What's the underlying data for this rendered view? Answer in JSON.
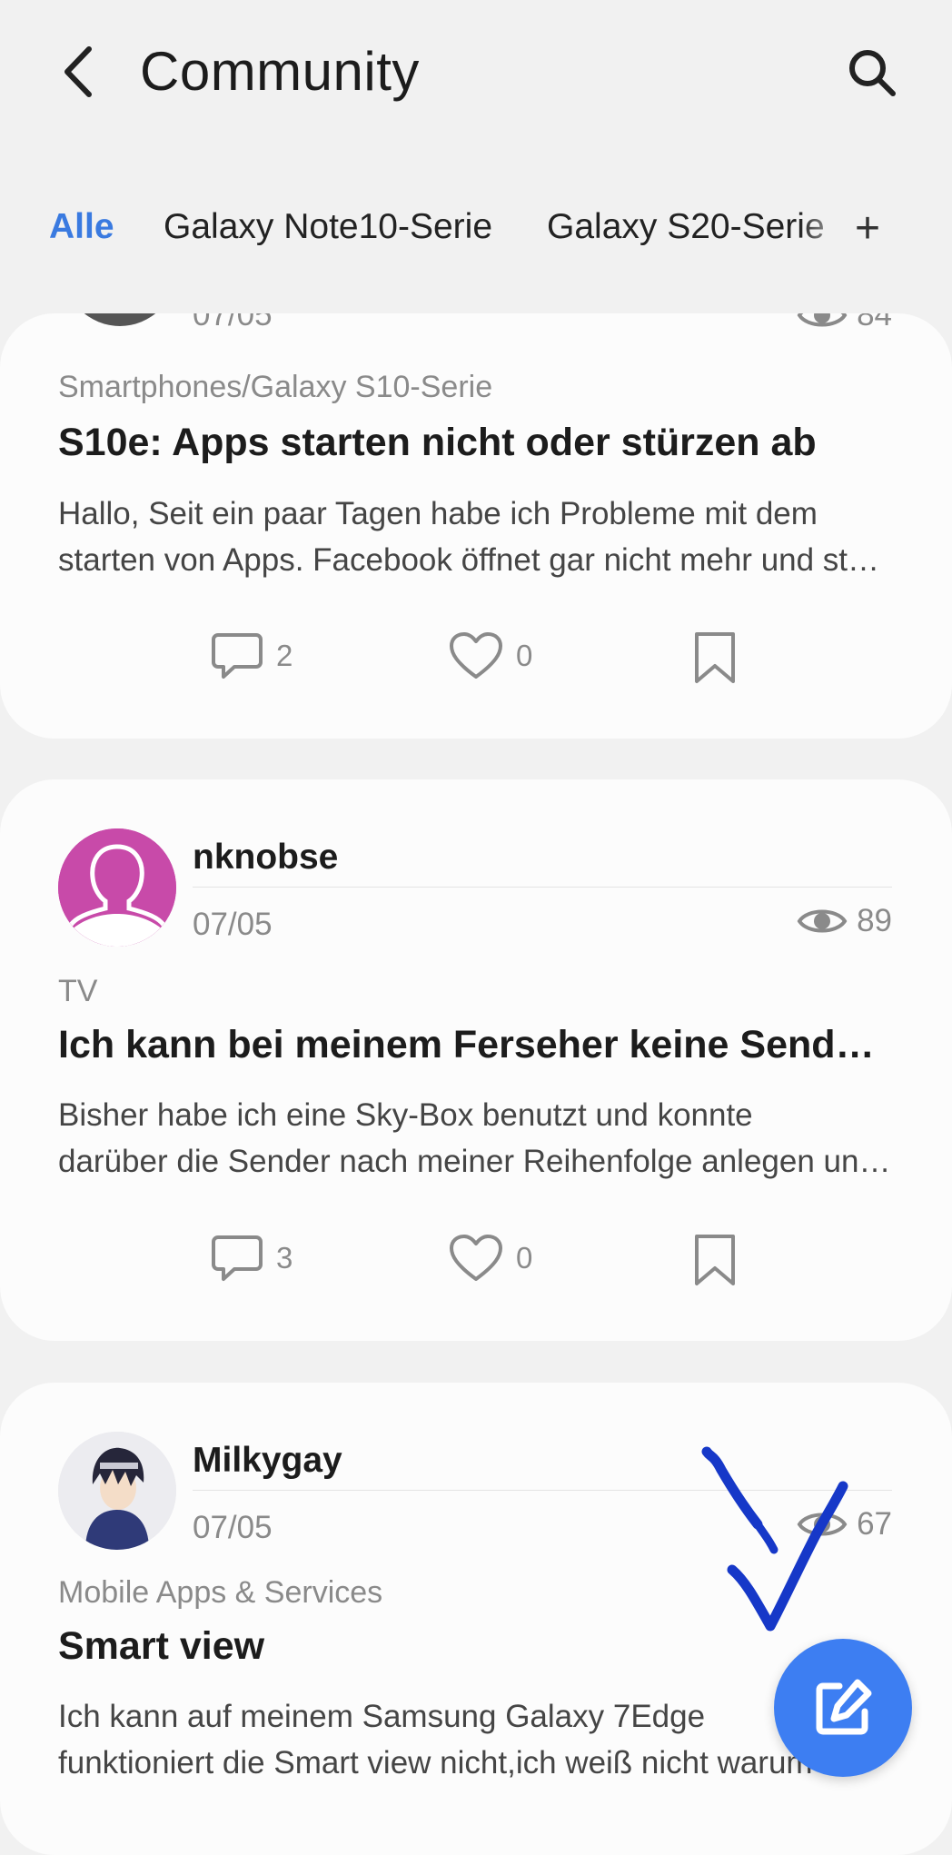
{
  "header": {
    "title": "Community",
    "back_icon": "chevron-left-icon",
    "search_icon": "search-icon"
  },
  "tabs": [
    {
      "label": "Alle",
      "active": true
    },
    {
      "label": "Galaxy Note10-Serie",
      "active": false
    },
    {
      "label": "Galaxy S20-Serie",
      "active": false
    }
  ],
  "tab_add_label": "+",
  "posts": [
    {
      "date": "07/05",
      "views": "84",
      "category": "Smartphones/Galaxy S10-Serie",
      "title": "S10e: Apps starten nicht oder stürzen ab",
      "excerpt_lines": [
        "Hallo, Seit ein paar Tagen habe ich Probleme mit dem",
        "starten von Apps. Facebook öffnet gar nicht mehr und stürzt ab"
      ],
      "comments": "2",
      "likes": "0"
    },
    {
      "author": "nknobse",
      "date": "07/05",
      "views": "89",
      "category": "TV",
      "title": "Ich kann bei meinem Ferseher keine Sender sortieren",
      "excerpt_lines": [
        "Bisher habe ich eine Sky-Box benutzt und konnte",
        "darüber die Sender nach meiner Reihenfolge anlegen und sortieren"
      ],
      "comments": "3",
      "likes": "0"
    },
    {
      "author": "Milkygay",
      "date": "07/05",
      "views": "67",
      "category": "Mobile Apps & Services",
      "title": "Smart view",
      "excerpt_lines": [
        "Ich kann auf meinem Samsung Galaxy 7Edge",
        "funktioniert die Smart view nicht,ich weiß nicht warum"
      ]
    }
  ],
  "colors": {
    "accent": "#3a7ae0",
    "fab": "#3d7ef2",
    "avatar_magenta": "#c84aa9",
    "annotation": "#1638c8"
  },
  "fab_icon": "compose-icon"
}
